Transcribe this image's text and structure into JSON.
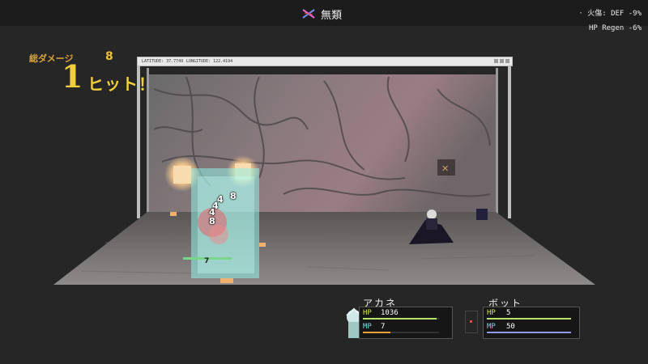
{
  "header": {
    "skill_icon": "crossed-swords-icon",
    "title": "無類",
    "status_lines": [
      "· 火傷: DEF -9%",
      "HP Regen -6%"
    ]
  },
  "combo": {
    "total_damage_label": "総ダメージ",
    "total_damage_value": "8",
    "hit_count": "1",
    "hit_label": "ヒット！"
  },
  "scene_window": {
    "latitude_text": "LATITUDE: 37.7749",
    "longitude_text": "LONGITUDE: 122.4194"
  },
  "damage_popups": [
    "4",
    "8",
    "4",
    "4",
    "8"
  ],
  "unit_tag": "7",
  "party": [
    {
      "name": "アカネ",
      "hp_label": "HP",
      "hp_value": "1036",
      "hp_fill": 0.97,
      "mp_label": "MP",
      "mp_value": "7",
      "mp_fill": 0.36
    }
  ],
  "enemies": [
    {
      "name": "ボット",
      "hp_label": "HP",
      "hp_value": "5",
      "hp_fill": 1.0,
      "mp_label": "MP",
      "mp_value": "50",
      "mp_fill": 1.0
    }
  ],
  "colors": {
    "hp_bar": "#b7e36b",
    "mp_bar_player": "#e8a23a",
    "mp_bar_enemy": "#8f9ae8",
    "combo_text": "#f2cf3a",
    "particles": "#8ff0e6"
  }
}
